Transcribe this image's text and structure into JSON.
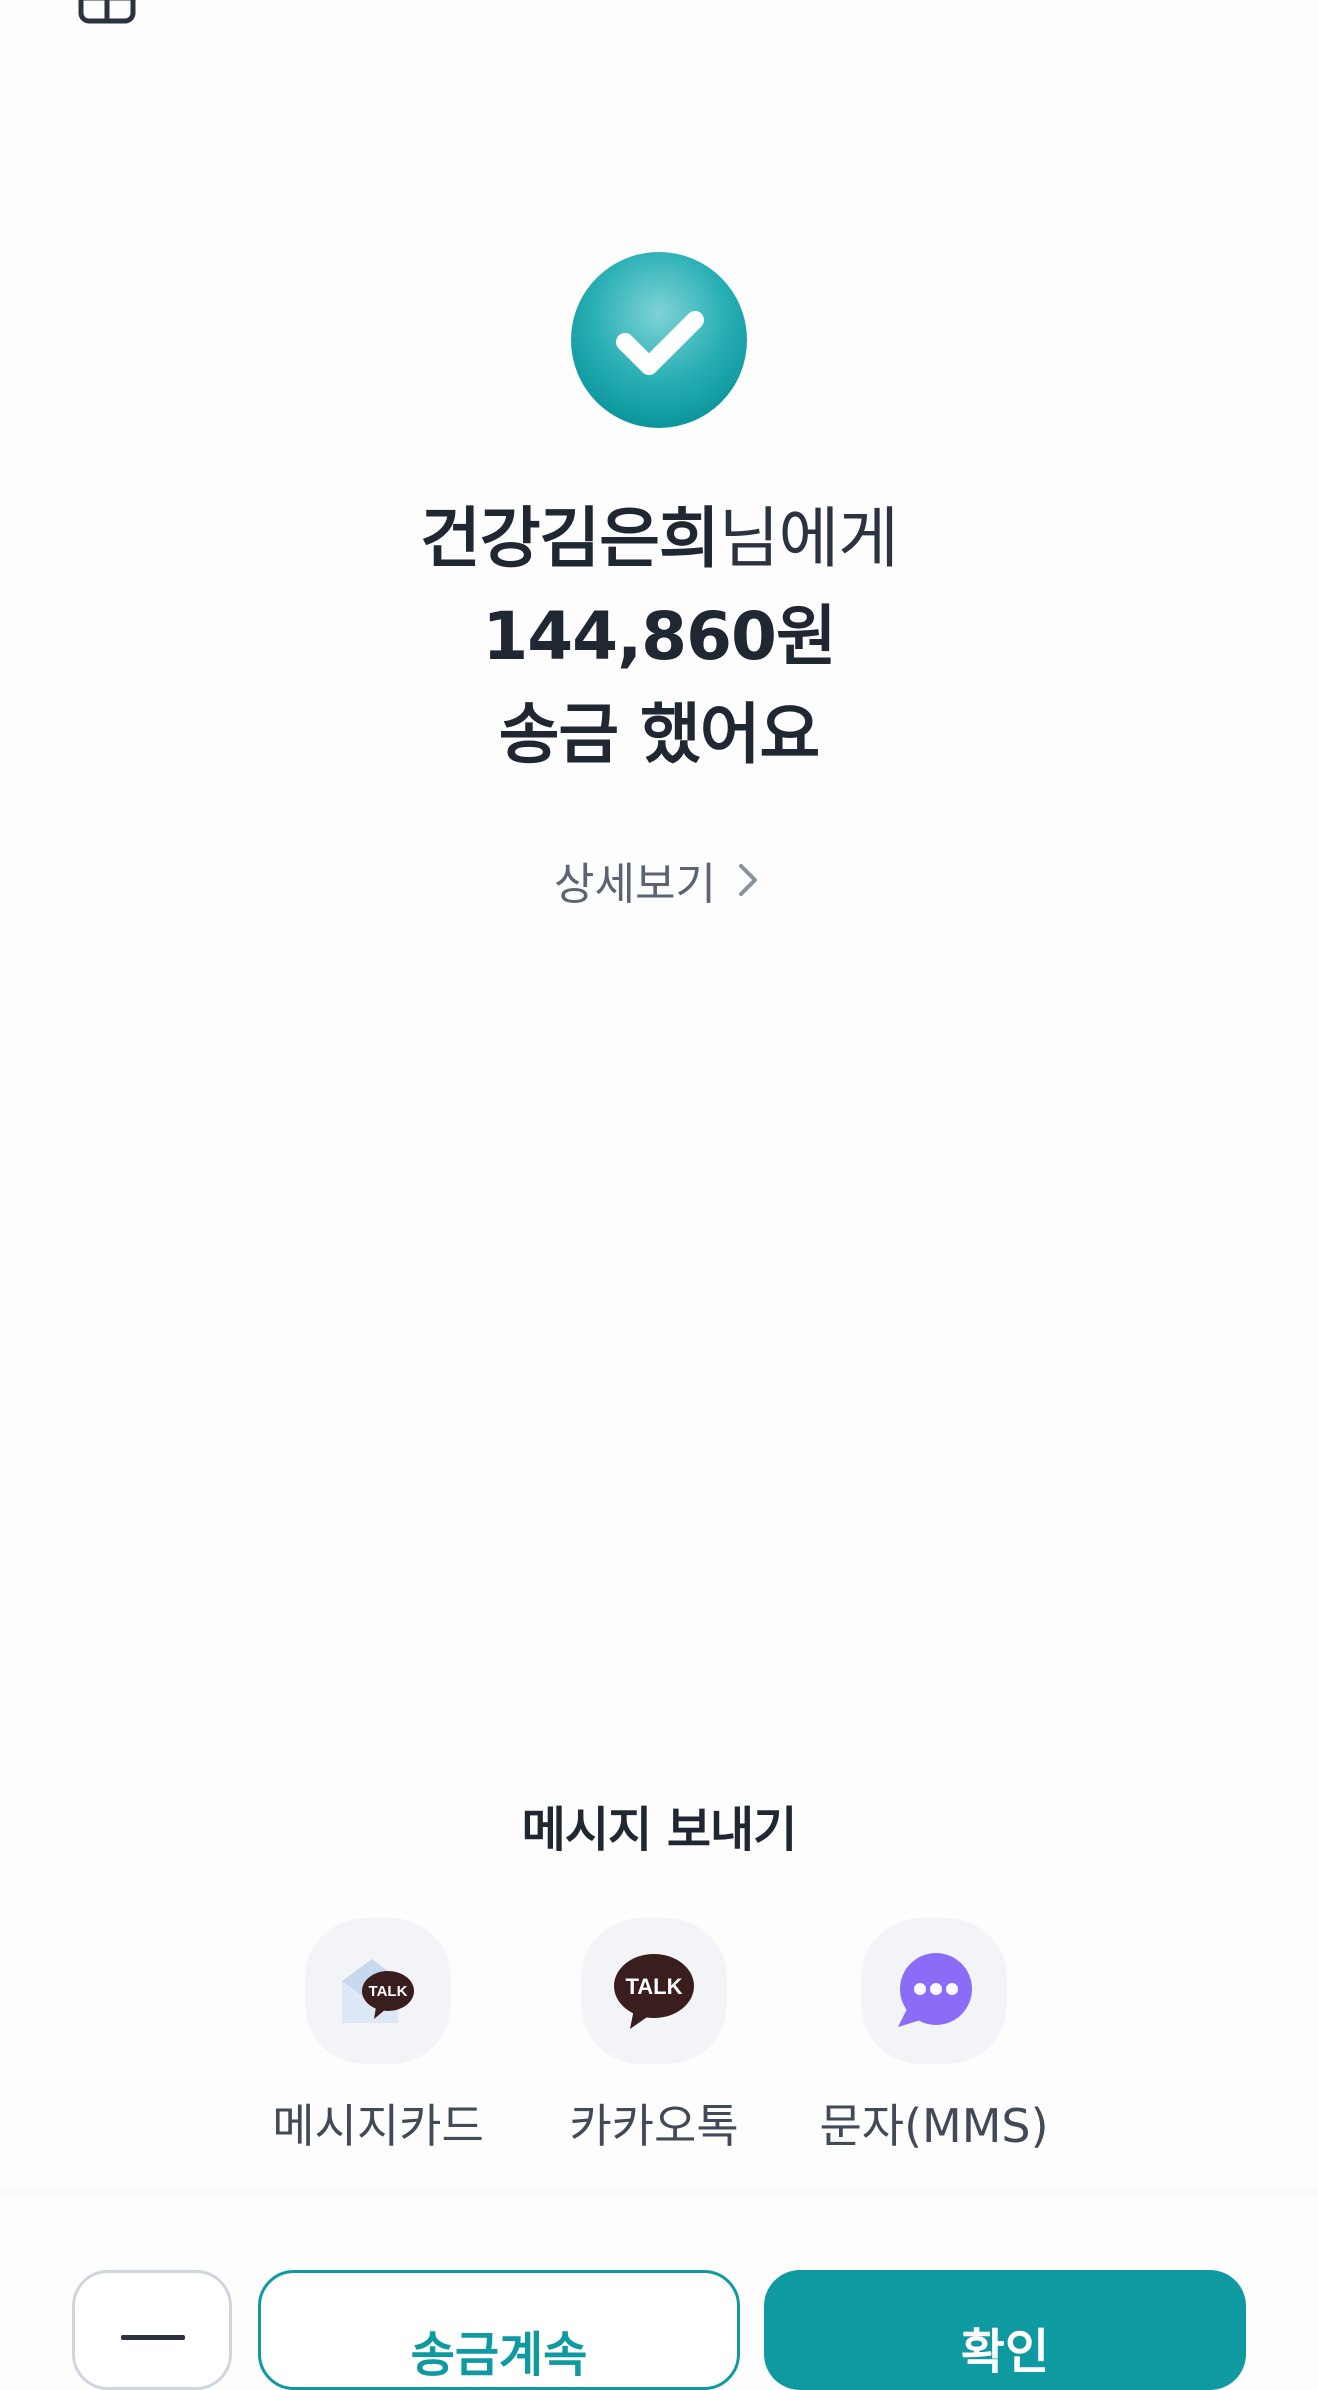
{
  "header": {
    "icon": "receipt-icon"
  },
  "result": {
    "icon": "check-circle-icon",
    "recipient_name": "건강김은희",
    "recipient_suffix": "님에게",
    "amount": "144,860원",
    "status": "송금 했어요",
    "detail_link": "상세보기"
  },
  "share": {
    "title": "메시지 보내기",
    "items": [
      {
        "label": "메시지카드",
        "icon": "message-card-icon"
      },
      {
        "label": "카카오톡",
        "icon": "kakaotalk-icon"
      },
      {
        "label": "문자(MMS)",
        "icon": "sms-bubble-icon"
      }
    ]
  },
  "footer": {
    "menu_icon": "menu-icon",
    "continue_label": "송금계속",
    "confirm_label": "확인"
  },
  "colors": {
    "accent": "#0e9aa0",
    "kakao_brown": "#3a1d1d",
    "sms_purple": "#8b6cf6"
  }
}
